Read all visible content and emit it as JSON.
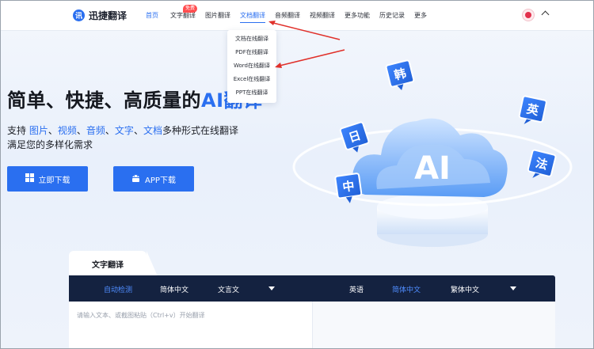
{
  "header": {
    "logo_text": "迅捷翻译",
    "logo_glyph": "讯",
    "nav": [
      {
        "label": "首页"
      },
      {
        "label": "文字翻译"
      },
      {
        "label": "图片翻译"
      },
      {
        "label": "文档翻译"
      },
      {
        "label": "音频翻译"
      },
      {
        "label": "视频翻译"
      },
      {
        "label": "更多功能"
      },
      {
        "label": "历史记录"
      },
      {
        "label": "更多"
      }
    ],
    "badge": "免费"
  },
  "dropdown": {
    "items": [
      {
        "label": "文档在线翻译"
      },
      {
        "label": "PDF在线翻译"
      },
      {
        "label": "Word在线翻译"
      },
      {
        "label": "Excel在线翻译"
      },
      {
        "label": "PPT在线翻译"
      }
    ]
  },
  "hero": {
    "title_a": "简单、快捷、高质量的",
    "title_b": "AI翻译",
    "sub_prefix": "支持 ",
    "sub_items": [
      "图片",
      "视频",
      "音频",
      "文字",
      "文档"
    ],
    "sub_suffix": "多种形式在线翻译",
    "sub2": "满足您的多样化需求",
    "btn_download": "立即下载",
    "btn_app": "APP下载"
  },
  "illustration": {
    "cloud_text": "AI",
    "bubbles": [
      "韩",
      "英",
      "日",
      "法",
      "中"
    ]
  },
  "panel": {
    "tab": "文字翻译",
    "source_langs": [
      "自动检测",
      "简体中文",
      "文言文"
    ],
    "target_langs": [
      "英语",
      "简体中文",
      "繁体中文"
    ],
    "placeholder": "请输入文本、或截图粘贴（Ctrl+v）开始翻译"
  },
  "colors": {
    "accent": "#2a6ff0",
    "dark_bar": "#142240",
    "badge": "#ff4d4f",
    "arrow": "#e0302a"
  }
}
